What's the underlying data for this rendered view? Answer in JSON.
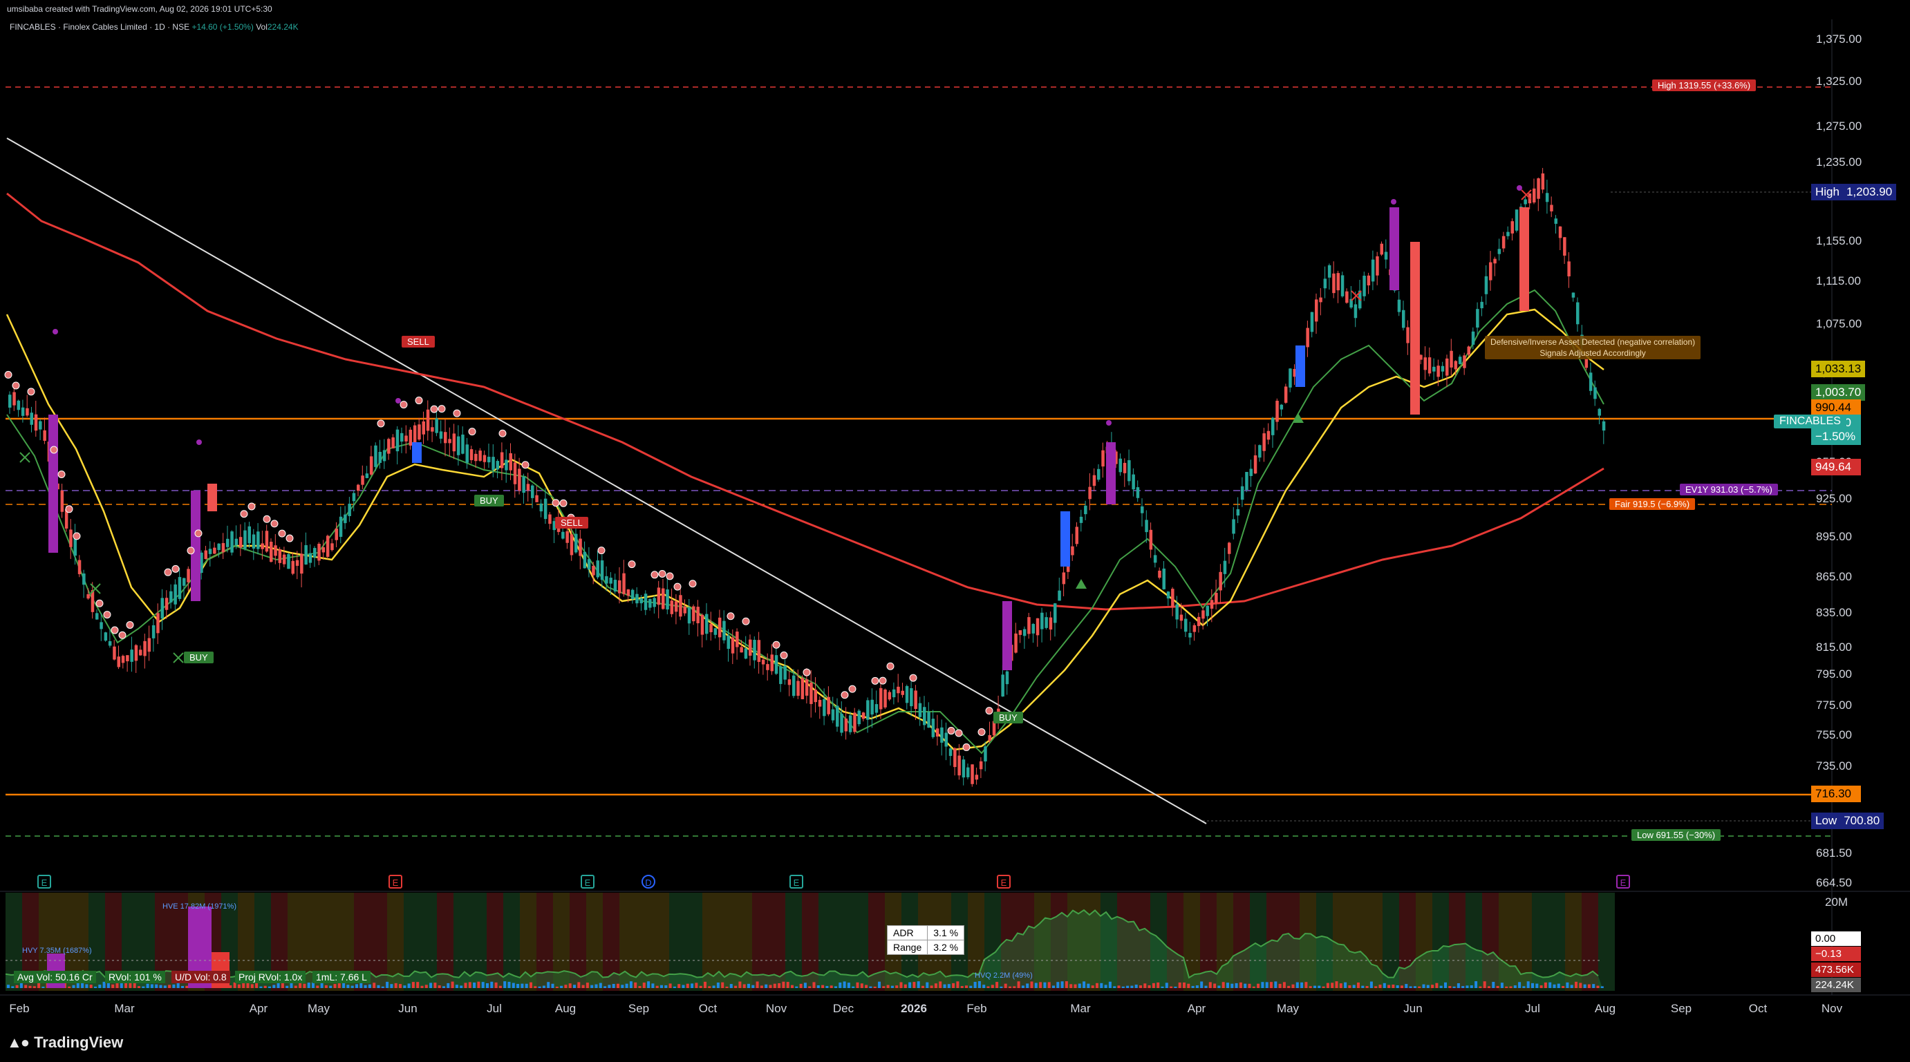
{
  "header": {
    "credit": "umsibaba created with TradingView.com, Aug 02, 2026 19:01 UTC+5:30",
    "symbol": "FINCABLES · Finolex Cables Limited · 1D · NSE",
    "change": "+14.60 (+1.50%)",
    "vol_label": "Vol",
    "vol_value": "224.24K"
  },
  "price_axis": {
    "ticks": [
      "1,375.00",
      "1,325.00",
      "1,275.00",
      "1,235.00",
      "1,195.00",
      "1,155.00",
      "1,115.00",
      "1,075.00",
      "1,035.00",
      "995.00",
      "955.00",
      "925.00",
      "895.00",
      "865.00",
      "835.00",
      "815.00",
      "795.00",
      "775.00",
      "755.00",
      "735.00",
      "715.00",
      "700.80",
      "681.50",
      "664.50"
    ],
    "high_label": "High",
    "high_value": "1,203.90",
    "low_label": "Low",
    "low_value": "700.80",
    "boxes": [
      {
        "value": "1,033.13",
        "color": "#c8b400",
        "text_color": "#000"
      },
      {
        "value": "1,003.70",
        "color": "#2e7d32",
        "text_color": "#fff"
      },
      {
        "value": "990.44",
        "color": "#f57c00",
        "text_color": "#000"
      },
      {
        "value": "987.60",
        "color": "#26a69a",
        "text_color": "#fff"
      },
      {
        "value": "−1.50%",
        "color": "#26a69a",
        "text_color": "#fff"
      },
      {
        "value": "949.64",
        "color": "#d32f2f",
        "text_color": "#fff"
      },
      {
        "value": "716.30",
        "color": "#f57c00",
        "text_color": "#000"
      }
    ],
    "symbol_tag": "FINCABLES"
  },
  "annotations": {
    "high_line": "High 1319.55 (+33.6%)",
    "low_line": "Low 691.55 (−30%)",
    "ev1y": "EV1Y 931.03 (−5.7%)",
    "fair": "Fair 919.5 (−6.9%)",
    "defensive": "Defensive/Inverse Asset Detected (negative correlation)",
    "defensive2": "Signals Adjusted Accordingly",
    "signals": [
      {
        "label": "SELL",
        "type": "sell"
      },
      {
        "label": "BUY",
        "type": "buy"
      },
      {
        "label": "SELL",
        "type": "sell"
      },
      {
        "label": "BUY",
        "type": "buy"
      },
      {
        "label": "BUY",
        "type": "buy"
      }
    ],
    "event_marks": [
      "E",
      "E",
      "E",
      "D",
      "E",
      "E",
      "E"
    ]
  },
  "indicator": {
    "axis_top": "20M",
    "boxes": [
      {
        "value": "0.00",
        "color": "#ffffff",
        "text_color": "#000"
      },
      {
        "value": "−0.13",
        "color": "#d32f2f",
        "text_color": "#fff"
      },
      {
        "value": "473.56K",
        "color": "#b71c1c",
        "text_color": "#fff"
      },
      {
        "value": "224.24K",
        "color": "#555555",
        "text_color": "#fff"
      }
    ],
    "hve_label": "HVE 17.82M (1971%)",
    "hvy_label": "HVY 7.35M (1687%)",
    "hvq_label": "HVQ 2.2M (49%)",
    "chips": [
      "Avg Vol: 50.16 Cr",
      "RVol: 101 %",
      "U/D Vol: 0.8",
      "Proj RVol: 1.0x",
      "1mL: 7.66 L"
    ],
    "adr_table": [
      [
        "ADR",
        "3.1 %"
      ],
      [
        "Range",
        "3.2 %"
      ]
    ]
  },
  "time_axis": [
    "Feb",
    "Mar",
    "Apr",
    "May",
    "Jun",
    "Jul",
    "Aug",
    "Sep",
    "Oct",
    "Nov",
    "Dec",
    "2026",
    "Feb",
    "Mar",
    "Apr",
    "May",
    "Jun",
    "Jul",
    "Aug",
    "Sep",
    "Oct",
    "Nov"
  ],
  "brand": "TradingView",
  "colors": {
    "up": "#26a69a",
    "down": "#ef5350",
    "ema_slow": "#e53935",
    "ema_mid": "#fdd835",
    "ema_fast": "#43a047",
    "hline": "#f57c00"
  }
}
